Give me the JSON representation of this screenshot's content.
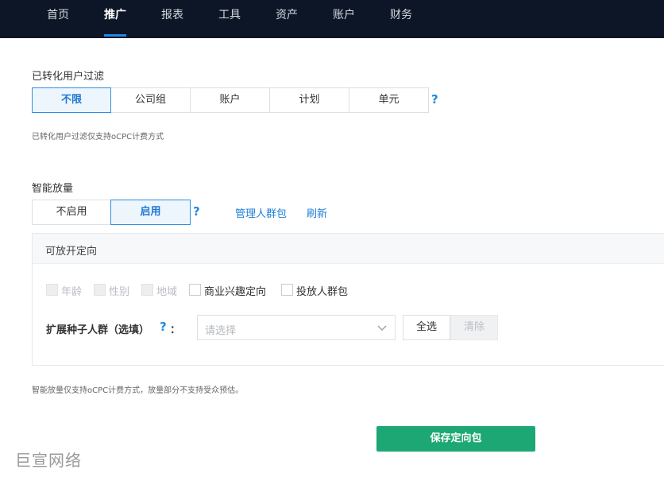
{
  "nav": {
    "items": [
      {
        "label": "首页"
      },
      {
        "label": "推广"
      },
      {
        "label": "报表"
      },
      {
        "label": "工具"
      },
      {
        "label": "资产"
      },
      {
        "label": "账户"
      },
      {
        "label": "财务"
      }
    ],
    "active": "推广"
  },
  "converted_filter": {
    "title": "已转化用户过滤",
    "options": [
      {
        "label": "不限"
      },
      {
        "label": "公司组"
      },
      {
        "label": "账户"
      },
      {
        "label": "计划"
      },
      {
        "label": "单元"
      }
    ],
    "selected": "不限",
    "help": "?",
    "hint": "已转化用户过滤仅支持oCPC计费方式"
  },
  "smart_expansion": {
    "title": "智能放量",
    "options": [
      {
        "label": "不启用"
      },
      {
        "label": "启用"
      }
    ],
    "selected": "启用",
    "help": "?",
    "links": {
      "manage": "管理人群包",
      "refresh": "刷新"
    },
    "panel": {
      "title": "可放开定向",
      "checkboxes": [
        {
          "label": "年龄",
          "disabled": true
        },
        {
          "label": "性别",
          "disabled": true
        },
        {
          "label": "地域",
          "disabled": true
        },
        {
          "label": "商业兴趣定向",
          "disabled": false
        },
        {
          "label": "投放人群包",
          "disabled": false
        }
      ],
      "seed_label": "扩展种子人群（选填）",
      "seed_help": "?",
      "seed_colon": "：",
      "select_placeholder": "请选择",
      "select_all": "全选",
      "clear": "清除"
    },
    "hint": "智能放量仅支持oCPC计费方式，放量部分不支持受众预估。"
  },
  "save_button": "保存定向包",
  "watermark": "巨宣网络",
  "colors": {
    "nav_bg": "#0c1626",
    "accent": "#1e88e5",
    "save_green": "#1da774"
  }
}
